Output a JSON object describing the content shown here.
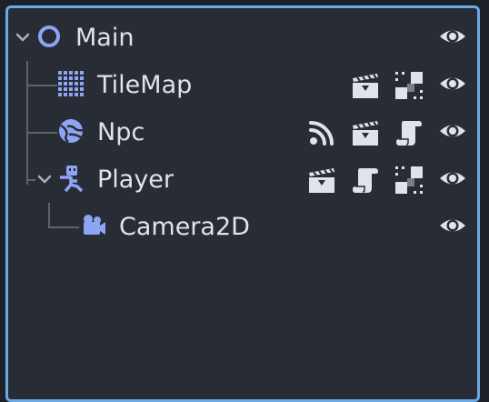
{
  "panel": {
    "border_color": "#6aa9e6",
    "background": "#272c35"
  },
  "tree": {
    "rows": [
      {
        "label": "Main",
        "node_icon": "node2d-ring-icon",
        "expanded": true,
        "status_icons": [
          "visibility-eye-icon"
        ]
      },
      {
        "label": "TileMap",
        "node_icon": "tilemap-grid-icon",
        "status_icons": [
          "scene-instance-clapper-icon",
          "grouped-checker-icon",
          "visibility-eye-icon"
        ]
      },
      {
        "label": "Npc",
        "node_icon": "world-globe-icon",
        "status_icons": [
          "signal-waves-icon",
          "scene-instance-clapper-icon",
          "script-scroll-icon",
          "visibility-eye-icon"
        ]
      },
      {
        "label": "Player",
        "node_icon": "character-body-icon",
        "expanded": true,
        "status_icons": [
          "scene-instance-clapper-icon",
          "script-scroll-icon",
          "grouped-checker-icon",
          "visibility-eye-icon"
        ]
      },
      {
        "label": "Camera2D",
        "node_icon": "camera-icon",
        "status_icons": [
          "visibility-eye-icon"
        ]
      }
    ]
  },
  "colors": {
    "node_icon": "#8da5f3",
    "status_icon": "#dfe3ea",
    "text": "#dfe3ea",
    "guide_line": "#5d6470"
  }
}
